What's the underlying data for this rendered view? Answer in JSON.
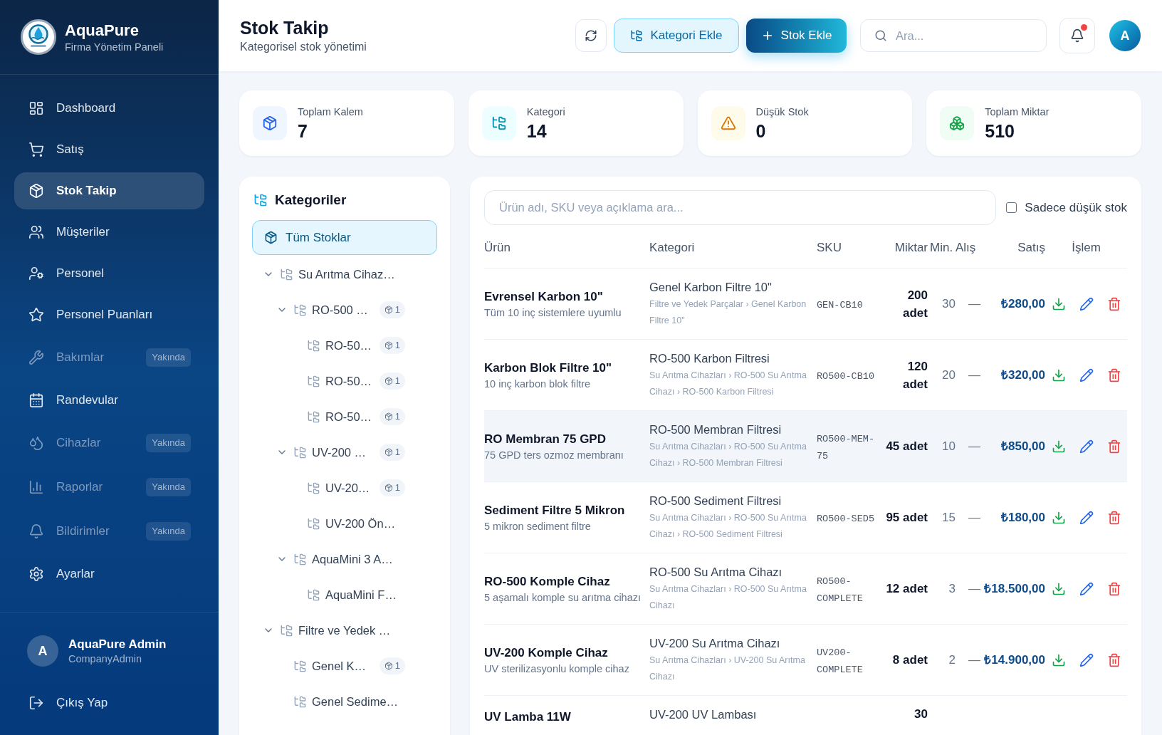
{
  "sidebar": {
    "brand": {
      "name": "AquaPure",
      "subtitle": "Firma Yönetim Paneli"
    },
    "items": [
      {
        "kind": "dashboard",
        "label": "Dashboard",
        "selected": false,
        "disabled": false
      },
      {
        "kind": "sales",
        "label": "Satış",
        "selected": false,
        "disabled": false
      },
      {
        "kind": "stock",
        "label": "Stok Takip",
        "selected": true,
        "disabled": false
      },
      {
        "kind": "customers",
        "label": "Müşteriler",
        "selected": false,
        "disabled": false
      },
      {
        "kind": "staff",
        "label": "Personel",
        "selected": false,
        "disabled": false
      },
      {
        "kind": "ratings",
        "label": "Personel Puanları",
        "selected": false,
        "disabled": false
      },
      {
        "kind": "maintenance",
        "label": "Bakımlar",
        "selected": false,
        "disabled": true,
        "badge": "Yakında"
      },
      {
        "kind": "appointments",
        "label": "Randevular",
        "selected": false,
        "disabled": false
      },
      {
        "kind": "devices",
        "label": "Cihazlar",
        "selected": false,
        "disabled": true,
        "badge": "Yakında"
      },
      {
        "kind": "reports",
        "label": "Raporlar",
        "selected": false,
        "disabled": true,
        "badge": "Yakında"
      },
      {
        "kind": "notifications",
        "label": "Bildirimler",
        "selected": false,
        "disabled": true,
        "badge": "Yakında"
      },
      {
        "kind": "settings",
        "label": "Ayarlar",
        "selected": false,
        "disabled": false
      }
    ],
    "user": {
      "initial": "A",
      "name": "AquaPure Admin",
      "role": "CompanyAdmin"
    },
    "logout": {
      "label": "Çıkış Yap"
    }
  },
  "header": {
    "title": "Stok Takip",
    "subtitle": "Kategorisel stok yönetimi",
    "actions": [
      {
        "kind": "secondary",
        "label": "Kategori Ekle"
      },
      {
        "kind": "primary",
        "label": "Stok Ekle"
      }
    ],
    "search": {
      "placeholder": "Ara..."
    },
    "notifications": {
      "unread": true
    },
    "avatar": {
      "initial": "A"
    }
  },
  "stats": [
    {
      "kind": "items",
      "label": "Toplam Kalem",
      "value": "7"
    },
    {
      "kind": "categories",
      "label": "Kategori",
      "value": "14"
    },
    {
      "kind": "low_stock",
      "label": "Düşük Stok",
      "value": "0"
    },
    {
      "kind": "quantity",
      "label": "Toplam Miktar",
      "value": "510"
    }
  ],
  "categories": {
    "title": "Kategoriler",
    "all": {
      "label": "Tüm Stoklar",
      "selected": true
    },
    "tree": [
      {
        "label": "Su Arıtma Cihaz…",
        "selected": false,
        "expanded": true,
        "children": [
          {
            "label": "RO-500 …",
            "selected": false,
            "expanded": true,
            "count": "1",
            "children": [
              {
                "label": "RO-50…",
                "selected": false,
                "count": "1"
              },
              {
                "label": "RO-50…",
                "selected": false,
                "count": "1"
              },
              {
                "label": "RO-50…",
                "selected": false,
                "count": "1"
              }
            ]
          },
          {
            "label": "UV-200 …",
            "selected": false,
            "expanded": true,
            "count": "1",
            "children": [
              {
                "label": "UV-20…",
                "selected": false,
                "count": "1"
              },
              {
                "label": "UV-200 Ön…",
                "selected": false
              }
            ]
          },
          {
            "label": "AquaMini 3 A…",
            "selected": false,
            "expanded": true,
            "children": [
              {
                "label": "AquaMini F…",
                "selected": false
              }
            ]
          }
        ]
      },
      {
        "label": "Filtre ve Yedek …",
        "selected": false,
        "expanded": true,
        "children": [
          {
            "label": "Genel K…",
            "selected": false,
            "count": "1"
          },
          {
            "label": "Genel Sedime…",
            "selected": false
          }
        ]
      }
    ]
  },
  "table": {
    "search": {
      "placeholder": "Ürün adı, SKU veya açıklama ara..."
    },
    "filter": {
      "label": "Sadece düşük stok",
      "checked": false
    },
    "columns": [
      "Ürün",
      "Kategori",
      "SKU",
      "Miktar",
      "Min.",
      "Alış",
      "Satış",
      "İşlem"
    ],
    "rows": [
      {
        "kind": "item",
        "hovered": false,
        "name": "Evrensel Karbon 10\"",
        "description": "Tüm 10 inç sistemlere uyumlu",
        "category": "Genel Karbon Filtre 10\"",
        "path": "Filtre ve Yedek Parçalar › Genel Karbon Filtre 10\"",
        "sku": "GEN-CB10",
        "quantity": "200 adet",
        "min": "30",
        "purchase": "—",
        "sale": "₺280,00"
      },
      {
        "kind": "item",
        "hovered": false,
        "name": "Karbon Blok Filtre 10\"",
        "description": "10 inç karbon blok filtre",
        "category": "RO-500 Karbon Filtresi",
        "path": "Su Arıtma Cihazları › RO-500 Su Arıtma Cihazı › RO-500 Karbon Filtresi",
        "sku": "RO500-CB10",
        "quantity": "120 adet",
        "min": "20",
        "purchase": "—",
        "sale": "₺320,00"
      },
      {
        "kind": "item",
        "hovered": true,
        "name": "RO Membran 75 GPD",
        "description": "75 GPD ters ozmoz membranı",
        "category": "RO-500 Membran Filtresi",
        "path": "Su Arıtma Cihazları › RO-500 Su Arıtma Cihazı › RO-500 Membran Filtresi",
        "sku": "RO500-MEM-75",
        "quantity": "45 adet",
        "min": "10",
        "purchase": "—",
        "sale": "₺850,00"
      },
      {
        "kind": "item",
        "hovered": false,
        "name": "Sediment Filtre 5 Mikron",
        "description": "5 mikron sediment filtre",
        "category": "RO-500 Sediment Filtresi",
        "path": "Su Arıtma Cihazları › RO-500 Su Arıtma Cihazı › RO-500 Sediment Filtresi",
        "sku": "RO500-SED5",
        "quantity": "95 adet",
        "min": "15",
        "purchase": "—",
        "sale": "₺180,00"
      },
      {
        "kind": "item",
        "hovered": false,
        "name": "RO-500 Komple Cihaz",
        "description": "5 aşamalı komple su arıtma cihazı",
        "category": "RO-500 Su Arıtma Cihazı",
        "path": "Su Arıtma Cihazları › RO-500 Su Arıtma Cihazı",
        "sku": "RO500-COMPLETE",
        "quantity": "12 adet",
        "min": "3",
        "purchase": "—",
        "sale": "₺18.500,00"
      },
      {
        "kind": "item",
        "hovered": false,
        "name": "UV-200 Komple Cihaz",
        "description": "UV sterilizasyonlu komple cihaz",
        "category": "UV-200 Su Arıtma Cihazı",
        "path": "Su Arıtma Cihazları › UV-200 Su Arıtma Cihazı",
        "sku": "UV200-COMPLETE",
        "quantity": "8 adet",
        "min": "2",
        "purchase": "—",
        "sale": "₺14.900,00"
      },
      {
        "kind": "partial",
        "hovered": false,
        "name": "UV Lamba 11W",
        "category": "UV-200 UV Lambası",
        "quantity": "30"
      }
    ]
  }
}
